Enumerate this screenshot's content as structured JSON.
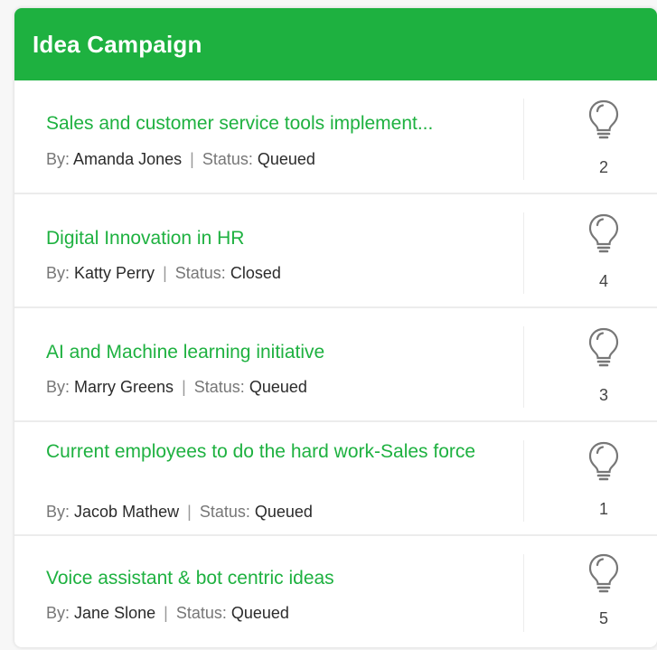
{
  "header": {
    "title": "Idea Campaign"
  },
  "labels": {
    "by": "By:",
    "status": "Status:",
    "separator": "|"
  },
  "colors": {
    "accent": "#1eb140"
  },
  "ideas": [
    {
      "title": "Sales and customer service tools implement...",
      "author": "Amanda Jones",
      "status": "Queued",
      "votes": "2",
      "icon": "lightbulb-icon"
    },
    {
      "title": "Digital Innovation in HR",
      "author": "Katty Perry",
      "status": "Closed",
      "votes": "4",
      "icon": "lightbulb-icon"
    },
    {
      "title": "AI and Machine learning initiative",
      "author": "Marry Greens",
      "status": "Queued",
      "votes": "3",
      "icon": "lightbulb-icon"
    },
    {
      "title": "Current employees to do the hard work-Sales force",
      "author": "Jacob Mathew",
      "status": "Queued",
      "votes": "1",
      "icon": "lightbulb-icon"
    },
    {
      "title": "Voice assistant & bot centric ideas",
      "author": "Jane Slone",
      "status": "Queued",
      "votes": "5",
      "icon": "lightbulb-icon"
    }
  ]
}
